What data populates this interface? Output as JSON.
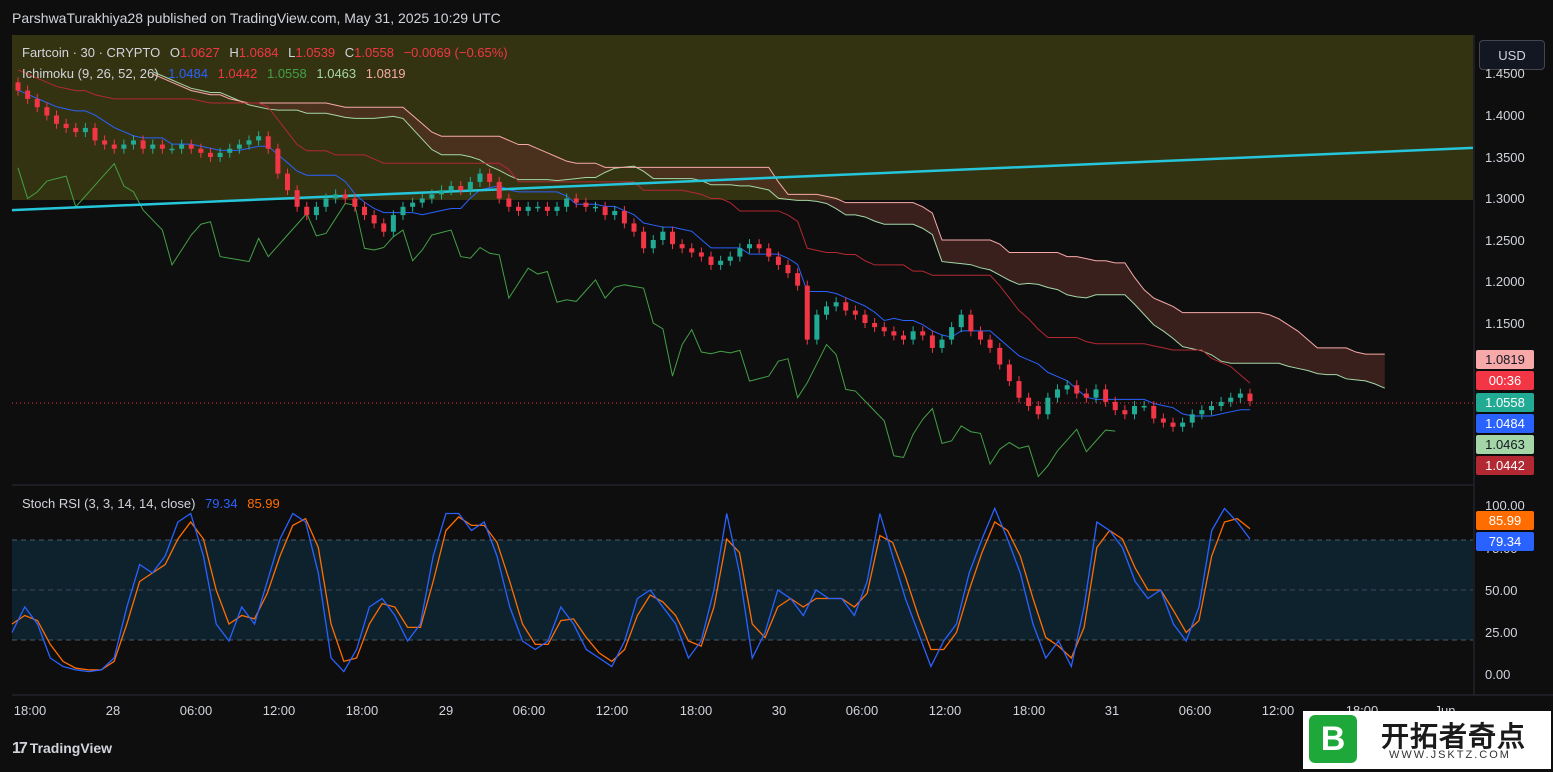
{
  "header": {
    "publish_line": "ParshwaTurakhiya28 published on TradingView.com, May 31, 2025 10:29 UTC"
  },
  "legend": {
    "symbol": "Fartcoin · 30 · CRYPTO",
    "o_label": "O",
    "o_value": "1.0627",
    "h_label": "H",
    "h_value": "1.0684",
    "l_label": "L",
    "l_value": "1.0539",
    "c_label": "C",
    "c_value": "1.0558",
    "change": "−0.0069 (−0.65%)",
    "ichimoku_label": "Ichimoku (9, 26, 52, 26)",
    "ichimoku_values": [
      "1.0484",
      "1.0442",
      "1.0558",
      "1.0463",
      "1.0819"
    ],
    "stoch_label": "Stoch RSI (3, 3, 14, 14, close)",
    "stoch_k": "79.34",
    "stoch_d": "85.99"
  },
  "currency_button": "USD",
  "price_axis": {
    "ticks": [
      "1.4500",
      "1.4000",
      "1.3500",
      "1.3000",
      "1.2500",
      "1.2000",
      "1.1500"
    ]
  },
  "price_tags": [
    {
      "text": "1.0819",
      "color": "#f7a9a9",
      "text_color": "#131722"
    },
    {
      "text": "00:36",
      "color": "#f23645",
      "text_color": "#ffffff"
    },
    {
      "text": "1.0558",
      "color": "#22ab94",
      "text_color": "#ffffff"
    },
    {
      "text": "1.0484",
      "color": "#2962ff",
      "text_color": "#ffffff"
    },
    {
      "text": "1.0463",
      "color": "#a5d6a7",
      "text_color": "#131722"
    },
    {
      "text": "1.0442",
      "color": "#b22833",
      "text_color": "#ffffff"
    }
  ],
  "rsi_axis": {
    "ticks": [
      "100.00",
      "75.00",
      "50.00",
      "25.00",
      "0.00"
    ]
  },
  "rsi_tags": [
    {
      "text": "85.99",
      "color": "#ff6d00"
    },
    {
      "text": "79.34",
      "color": "#2962ff"
    }
  ],
  "time_axis": [
    "18:00",
    "28",
    "06:00",
    "12:00",
    "18:00",
    "29",
    "06:00",
    "12:00",
    "18:00",
    "30",
    "06:00",
    "12:00",
    "18:00",
    "31",
    "06:00",
    "12:00",
    "18:00",
    "Jun"
  ],
  "branding": "TradingView",
  "watermark": {
    "letter": "B",
    "title": "开拓者奇点",
    "url": "WWW.JSKTZ.COM"
  },
  "colors": {
    "up": "#22ab94",
    "down": "#f23645",
    "conversion": "#2962ff",
    "base": "#b22833",
    "lagging": "#43a047",
    "span_a": "#a5d6a7",
    "span_b": "#f7a9a9",
    "trendline": "#26c6da",
    "stoch_k": "#2962ff",
    "stoch_d": "#ff6d00"
  },
  "chart_data": [
    {
      "type": "candlestick",
      "symbol": "Fartcoin",
      "interval": "30",
      "indicator": "Ichimoku (9, 26, 52, 26)",
      "ylim": [
        1.02,
        1.46
      ],
      "x_ticks": [
        "18:00",
        "28",
        "06:00",
        "12:00",
        "18:00",
        "29",
        "06:00",
        "12:00",
        "18:00",
        "30",
        "06:00",
        "12:00",
        "18:00",
        "31",
        "06:00",
        "12:00",
        "18:00",
        "Jun"
      ],
      "close_series": [
        1.43,
        1.42,
        1.41,
        1.4,
        1.39,
        1.385,
        1.38,
        1.385,
        1.37,
        1.365,
        1.36,
        1.365,
        1.37,
        1.36,
        1.365,
        1.36,
        1.36,
        1.365,
        1.36,
        1.355,
        1.35,
        1.355,
        1.36,
        1.365,
        1.37,
        1.375,
        1.36,
        1.33,
        1.31,
        1.29,
        1.28,
        1.29,
        1.3,
        1.305,
        1.3,
        1.29,
        1.28,
        1.27,
        1.26,
        1.28,
        1.29,
        1.295,
        1.3,
        1.305,
        1.31,
        1.315,
        1.31,
        1.32,
        1.33,
        1.32,
        1.3,
        1.29,
        1.285,
        1.29,
        1.29,
        1.285,
        1.29,
        1.3,
        1.295,
        1.29,
        1.29,
        1.28,
        1.285,
        1.27,
        1.26,
        1.24,
        1.25,
        1.26,
        1.245,
        1.24,
        1.235,
        1.23,
        1.22,
        1.225,
        1.23,
        1.24,
        1.245,
        1.24,
        1.23,
        1.22,
        1.21,
        1.195,
        1.13,
        1.16,
        1.17,
        1.175,
        1.165,
        1.16,
        1.15,
        1.145,
        1.14,
        1.135,
        1.13,
        1.14,
        1.135,
        1.12,
        1.13,
        1.145,
        1.16,
        1.14,
        1.13,
        1.12,
        1.1,
        1.08,
        1.06,
        1.05,
        1.04,
        1.06,
        1.07,
        1.075,
        1.065,
        1.06,
        1.07,
        1.055,
        1.045,
        1.04,
        1.05,
        1.05,
        1.035,
        1.03,
        1.025,
        1.03,
        1.04,
        1.045,
        1.05,
        1.055,
        1.06,
        1.065,
        1.0558
      ],
      "last_close": 1.0558,
      "ichimoku_last": {
        "conversion": 1.0484,
        "base": 1.0442,
        "lagging": 1.0558,
        "span_a": 1.0463,
        "span_b": 1.0819
      },
      "trendline": {
        "start": 1.286,
        "end": 1.361
      }
    },
    {
      "type": "line",
      "indicator": "Stoch RSI (3, 3, 14, 14, close)",
      "ylim": [
        0,
        100
      ],
      "bands": [
        20,
        50,
        80
      ],
      "series": [
        {
          "name": "K",
          "values": [
            25,
            40,
            30,
            10,
            5,
            3,
            2,
            3,
            10,
            40,
            65,
            60,
            70,
            90,
            95,
            70,
            30,
            20,
            40,
            30,
            55,
            80,
            95,
            90,
            60,
            10,
            2,
            15,
            40,
            45,
            35,
            20,
            30,
            70,
            95,
            95,
            85,
            90,
            70,
            40,
            20,
            15,
            20,
            40,
            30,
            15,
            10,
            5,
            20,
            45,
            50,
            40,
            30,
            10,
            20,
            50,
            95,
            60,
            10,
            25,
            50,
            45,
            35,
            50,
            45,
            45,
            35,
            55,
            95,
            70,
            45,
            25,
            5,
            20,
            30,
            60,
            80,
            98,
            80,
            60,
            30,
            10,
            20,
            5,
            40,
            90,
            85,
            75,
            55,
            45,
            50,
            30,
            20,
            40,
            85,
            98,
            90,
            80
          ]
        },
        {
          "name": "D",
          "values": [
            30,
            35,
            32,
            18,
            8,
            4,
            3,
            3,
            8,
            30,
            55,
            60,
            65,
            80,
            90,
            80,
            50,
            30,
            35,
            33,
            48,
            70,
            88,
            92,
            75,
            30,
            8,
            10,
            30,
            42,
            40,
            28,
            28,
            55,
            85,
            93,
            88,
            88,
            78,
            55,
            30,
            18,
            18,
            32,
            33,
            22,
            13,
            8,
            15,
            35,
            47,
            43,
            35,
            20,
            17,
            40,
            80,
            72,
            30,
            22,
            40,
            45,
            40,
            45,
            45,
            45,
            40,
            48,
            82,
            78,
            58,
            35,
            15,
            15,
            25,
            50,
            72,
            90,
            85,
            70,
            45,
            22,
            17,
            10,
            28,
            75,
            85,
            80,
            63,
            50,
            50,
            38,
            25,
            32,
            70,
            90,
            92,
            86
          ]
        }
      ],
      "last": {
        "K": 79.34,
        "D": 85.99
      }
    }
  ]
}
